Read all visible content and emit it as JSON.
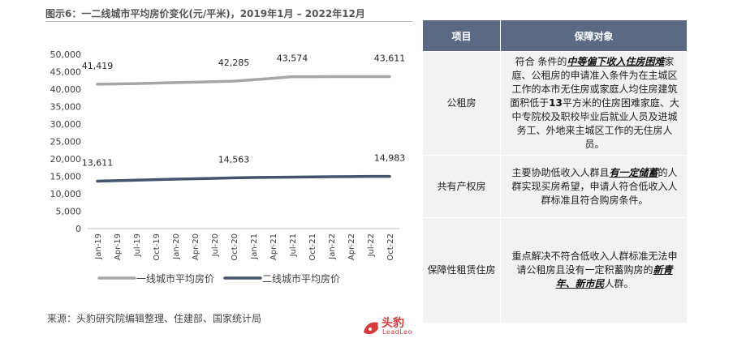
{
  "title": "图示6：一二线城市平均房价变化(元/平米)，2019年1月 – 2022年12月",
  "source": "来源：头豹研究院编辑整理、住建部、国家统计局",
  "logo": {
    "name": "头豹",
    "sub": "LeadLeo"
  },
  "colors": {
    "tier1": "#a6a6a6",
    "tier2": "#44546a",
    "header": "#5b6a84",
    "cell": "#f2f2f2"
  },
  "chart_data": {
    "type": "line",
    "title": "一二线城市平均房价变化(元/平米)",
    "yticks": [
      "0",
      "5,000",
      "10,000",
      "15,000",
      "20,000",
      "25,000",
      "30,000",
      "35,000",
      "40,000",
      "45,000",
      "50,000"
    ],
    "ylim": [
      0,
      50000
    ],
    "x": [
      "Jan-19",
      "Apr-19",
      "Jul-19",
      "Oct-19",
      "Jan-20",
      "Apr-20",
      "Jul-20",
      "Oct-20",
      "Jan-21",
      "Apr-21",
      "Jul-21",
      "Oct-21",
      "Jan-22",
      "Apr-22",
      "Jul-22",
      "Oct-22"
    ],
    "legend_position": "bottom",
    "series": [
      {
        "name": "一线城市平均房价",
        "color": "#a6a6a6",
        "values": [
          41419,
          41500,
          41600,
          41750,
          41900,
          42000,
          42150,
          42285,
          42700,
          43100,
          43574,
          43580,
          43600,
          43605,
          43611,
          43611
        ],
        "labels": [
          {
            "index": 0,
            "text": "41,419"
          },
          {
            "index": 7,
            "text": "42,285"
          },
          {
            "index": 10,
            "text": "43,574"
          },
          {
            "index": 15,
            "text": "43,611"
          }
        ]
      },
      {
        "name": "二线城市平均房价",
        "color": "#44546a",
        "values": [
          13611,
          13750,
          13900,
          14050,
          14200,
          14300,
          14420,
          14563,
          14650,
          14720,
          14780,
          14830,
          14880,
          14920,
          14960,
          14983
        ],
        "labels": [
          {
            "index": 0,
            "text": "13,611"
          },
          {
            "index": 7,
            "text": "14,563"
          },
          {
            "index": 15,
            "text": "14,983"
          }
        ]
      }
    ]
  },
  "table": {
    "headers": [
      "项目",
      "保障对象"
    ],
    "rows": [
      {
        "name": "公租房",
        "parts": [
          {
            "t": "符合 条件的",
            "s": ""
          },
          {
            "t": "中等偏下收入住房困难",
            "s": "hl"
          },
          {
            "t": "家庭、公租房的申请准入条件为在主城区工作的本市无住房或家庭人均住房建筑面积低于",
            "s": ""
          },
          {
            "t": "13",
            "s": "bold"
          },
          {
            "t": "平方米的住房困难家庭、大中专院校及职校毕业后就业人员及进城务工、外地来主城区工作的无住房人员。",
            "s": ""
          }
        ]
      },
      {
        "name": "共有产权房",
        "parts": [
          {
            "t": "主要协助低收入人群且",
            "s": ""
          },
          {
            "t": "有一定储蓄",
            "s": "hl"
          },
          {
            "t": "的人群实现买房希望，申请人符合低收入人群标准且符合购房条件。",
            "s": ""
          }
        ]
      },
      {
        "name": "保障性租赁住房",
        "parts": [
          {
            "t": "重点解决不符合低收入人群标准无法申请公租房且没有一定积蓄购房的",
            "s": ""
          },
          {
            "t": "新青年、新市民",
            "s": "hl"
          },
          {
            "t": "人群。",
            "s": ""
          }
        ]
      }
    ]
  }
}
